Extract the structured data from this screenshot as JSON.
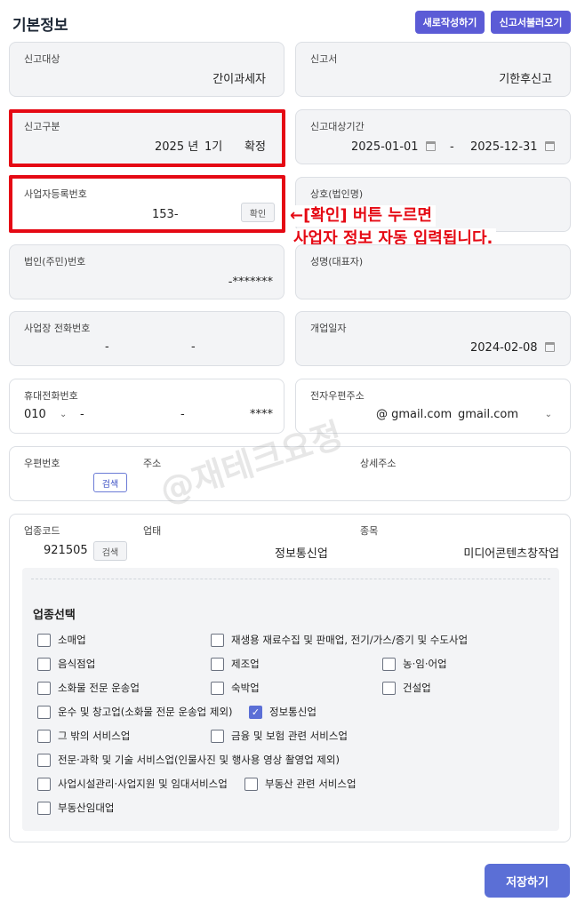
{
  "header": {
    "title": "기본정보",
    "new_button": "새로작성하기",
    "load_button": "신고서불러오기"
  },
  "fields": {
    "report_target": {
      "label": "신고대상",
      "value": "간이과세자"
    },
    "report_form": {
      "label": "신고서",
      "value": "기한후신고"
    },
    "report_type": {
      "label": "신고구분",
      "year": "2025 년",
      "period": "1기",
      "kind": "확정"
    },
    "report_period": {
      "label": "신고대상기간",
      "start": "2025-01-01",
      "sep": "-",
      "end": "2025-12-31"
    },
    "biz_reg_no": {
      "label": "사업자등록번호",
      "value": "153-",
      "confirm_button": "확인"
    },
    "company_name": {
      "label": "상호(법인명)",
      "value": ""
    },
    "corp_no": {
      "label": "법인(주민)번호",
      "value": "-*******"
    },
    "rep_name": {
      "label": "성명(대표자)",
      "value": ""
    },
    "biz_phone": {
      "label": "사업장 전화번호",
      "sep1": "-",
      "sep2": "-"
    },
    "open_date": {
      "label": "개업일자",
      "value": "2024-02-08"
    },
    "mobile": {
      "label": "휴대전화번호",
      "prefix": "010",
      "sep1": "-",
      "sep2": "-",
      "masked": "****"
    },
    "email": {
      "label": "전자우편주소",
      "at": "@ gmail.com",
      "domain": "gmail.com"
    },
    "address": {
      "zip_label": "우편번호",
      "addr_label": "주소",
      "detail_label": "상세주소",
      "search_button": "검색"
    },
    "industry": {
      "code_label": "업종코드",
      "code": "921505",
      "search_button": "검색",
      "biz_label": "업태",
      "biz_value": "정보통신업",
      "item_label": "종목",
      "item_value": "미디어콘텐츠창작업"
    }
  },
  "annotation": {
    "line1": "←[확인] 버튼 누르면",
    "line2": "사업자 정보 자동 입력됩니다."
  },
  "industry_select": {
    "title": "업종선택",
    "options": [
      {
        "label": "소매업",
        "checked": false
      },
      {
        "label": "재생용 재료수집 및 판매업, 전기/가스/증기 및 수도사업",
        "checked": false
      },
      {
        "label": "음식점업",
        "checked": false
      },
      {
        "label": "제조업",
        "checked": false
      },
      {
        "label": "농·임·어업",
        "checked": false
      },
      {
        "label": "소화물 전문 운송업",
        "checked": false
      },
      {
        "label": "숙박업",
        "checked": false
      },
      {
        "label": "건설업",
        "checked": false
      },
      {
        "label": "운수 및 창고업(소화물 전문 운송업 제외)",
        "checked": false
      },
      {
        "label": "정보통신업",
        "checked": true
      },
      {
        "label": "그 밖의 서비스업",
        "checked": false
      },
      {
        "label": "금융 및 보험 관련 서비스업",
        "checked": false
      },
      {
        "label": "전문·과학 및 기술 서비스업(인물사진 및 행사용 영상 촬영업 제외)",
        "checked": false
      },
      {
        "label": "사업시설관리·사업지원 및 임대서비스업",
        "checked": false
      },
      {
        "label": "부동산 관련 서비스업",
        "checked": false
      },
      {
        "label": "부동산임대업",
        "checked": false
      }
    ]
  },
  "save_button": "저장하기",
  "watermark": "@재테크요정"
}
